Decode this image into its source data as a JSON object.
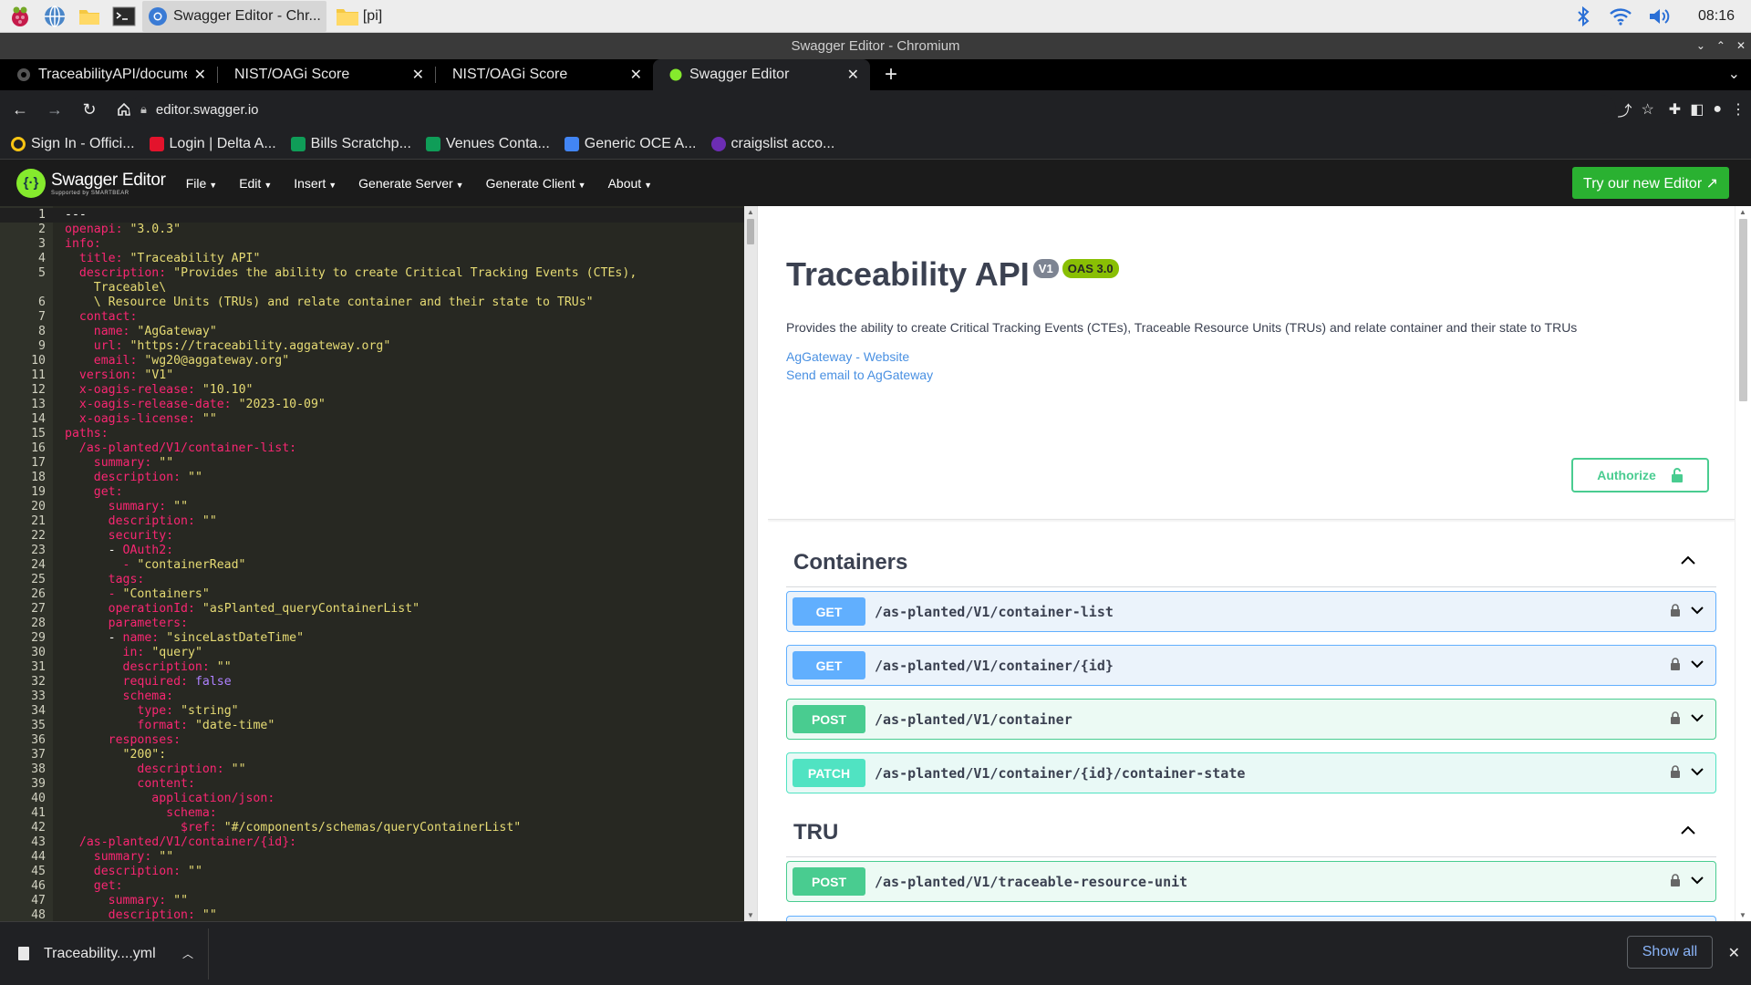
{
  "taskbar": {
    "window_button": "Swagger Editor - Chr...",
    "folder_button": "[pi]",
    "clock": "08:16"
  },
  "window": {
    "title": "Swagger Editor - Chromium"
  },
  "tabs": [
    {
      "title": "TraceabilityAPI/documen",
      "active": false
    },
    {
      "title": "NIST/OAGi Score",
      "active": false
    },
    {
      "title": "NIST/OAGi Score",
      "active": false
    },
    {
      "title": "Swagger Editor",
      "active": true
    }
  ],
  "address_bar": {
    "url": "editor.swagger.io"
  },
  "bookmarks": [
    {
      "label": "Sign In - Offici...",
      "color": "#f9c513"
    },
    {
      "label": "Login | Delta A...",
      "color": "#e3132c"
    },
    {
      "label": "Bills Scratchp...",
      "color": "#0f9d58"
    },
    {
      "label": "Venues Conta...",
      "color": "#0f9d58"
    },
    {
      "label": "Generic OCE A...",
      "color": "#4285f4"
    },
    {
      "label": "craigslist acco...",
      "color": "#6c2db3"
    }
  ],
  "swagger_topbar": {
    "logo_title": "Swagger Editor",
    "logo_sub": "Supported by SMARTBEAR",
    "menu": [
      "File",
      "Edit",
      "Insert",
      "Generate Server",
      "Generate Client",
      "About"
    ],
    "try_button": "Try our new Editor ↗"
  },
  "editor_lines": [
    {
      "n": "1",
      "code": "---"
    },
    {
      "n": "2",
      "code": "openapi: \"3.0.3\""
    },
    {
      "n": "3",
      "code": "info:"
    },
    {
      "n": "4",
      "code": "  title: \"Traceability API\""
    },
    {
      "n": "5",
      "code": "  description: \"Provides the ability to create Critical Tracking Events (CTEs),"
    },
    {
      "n": "",
      "code": "    Traceable\\"
    },
    {
      "n": "6",
      "code": "    \\ Resource Units (TRUs) and relate container and their state to TRUs\""
    },
    {
      "n": "7",
      "code": "  contact:"
    },
    {
      "n": "8",
      "code": "    name: \"AgGateway\""
    },
    {
      "n": "9",
      "code": "    url: \"https://traceability.aggateway.org\""
    },
    {
      "n": "10",
      "code": "    email: \"wg20@aggateway.org\""
    },
    {
      "n": "11",
      "code": "  version: \"V1\""
    },
    {
      "n": "12",
      "code": "  x-oagis-release: \"10.10\""
    },
    {
      "n": "13",
      "code": "  x-oagis-release-date: \"2023-10-09\""
    },
    {
      "n": "14",
      "code": "  x-oagis-license: \"\""
    },
    {
      "n": "15",
      "code": "paths:"
    },
    {
      "n": "16",
      "code": "  /as-planted/V1/container-list:"
    },
    {
      "n": "17",
      "code": "    summary: \"\""
    },
    {
      "n": "18",
      "code": "    description: \"\""
    },
    {
      "n": "19",
      "code": "    get:"
    },
    {
      "n": "20",
      "code": "      summary: \"\""
    },
    {
      "n": "21",
      "code": "      description: \"\""
    },
    {
      "n": "22",
      "code": "      security:"
    },
    {
      "n": "23",
      "code": "      - OAuth2:"
    },
    {
      "n": "24",
      "code": "        - \"containerRead\""
    },
    {
      "n": "25",
      "code": "      tags:"
    },
    {
      "n": "26",
      "code": "      - \"Containers\""
    },
    {
      "n": "27",
      "code": "      operationId: \"asPlanted_queryContainerList\""
    },
    {
      "n": "28",
      "code": "      parameters:"
    },
    {
      "n": "29",
      "code": "      - name: \"sinceLastDateTime\""
    },
    {
      "n": "30",
      "code": "        in: \"query\""
    },
    {
      "n": "31",
      "code": "        description: \"\""
    },
    {
      "n": "32",
      "code": "        required: false"
    },
    {
      "n": "33",
      "code": "        schema:"
    },
    {
      "n": "34",
      "code": "          type: \"string\""
    },
    {
      "n": "35",
      "code": "          format: \"date-time\""
    },
    {
      "n": "36",
      "code": "      responses:"
    },
    {
      "n": "37",
      "code": "        \"200\":"
    },
    {
      "n": "38",
      "code": "          description: \"\""
    },
    {
      "n": "39",
      "code": "          content:"
    },
    {
      "n": "40",
      "code": "            application/json:"
    },
    {
      "n": "41",
      "code": "              schema:"
    },
    {
      "n": "42",
      "code": "                $ref: \"#/components/schemas/queryContainerList\""
    },
    {
      "n": "43",
      "code": "  /as-planted/V1/container/{id}:"
    },
    {
      "n": "44",
      "code": "    summary: \"\""
    },
    {
      "n": "45",
      "code": "    description: \"\""
    },
    {
      "n": "46",
      "code": "    get:"
    },
    {
      "n": "47",
      "code": "      summary: \"\""
    },
    {
      "n": "48",
      "code": "      description: \"\""
    }
  ],
  "preview": {
    "title": "Traceability API",
    "version_badge": "V1",
    "oas_badge": "OAS 3.0",
    "description": "Provides the ability to create Critical Tracking Events (CTEs), Traceable Resource Units (TRUs) and relate container and their state to TRUs",
    "link_website": "AgGateway - Website",
    "link_email": "Send email to AgGateway",
    "authorize": "Authorize",
    "tags": [
      {
        "name": "Containers",
        "operations": [
          {
            "method": "GET",
            "path": "/as-planted/V1/container-list"
          },
          {
            "method": "GET",
            "path": "/as-planted/V1/container/{id}"
          },
          {
            "method": "POST",
            "path": "/as-planted/V1/container"
          },
          {
            "method": "PATCH",
            "path": "/as-planted/V1/container/{id}/container-state"
          }
        ]
      },
      {
        "name": "TRU",
        "operations": [
          {
            "method": "POST",
            "path": "/as-planted/V1/traceable-resource-unit"
          }
        ]
      }
    ]
  },
  "download_bar": {
    "file_name": "Traceability....yml",
    "show_all": "Show all"
  }
}
